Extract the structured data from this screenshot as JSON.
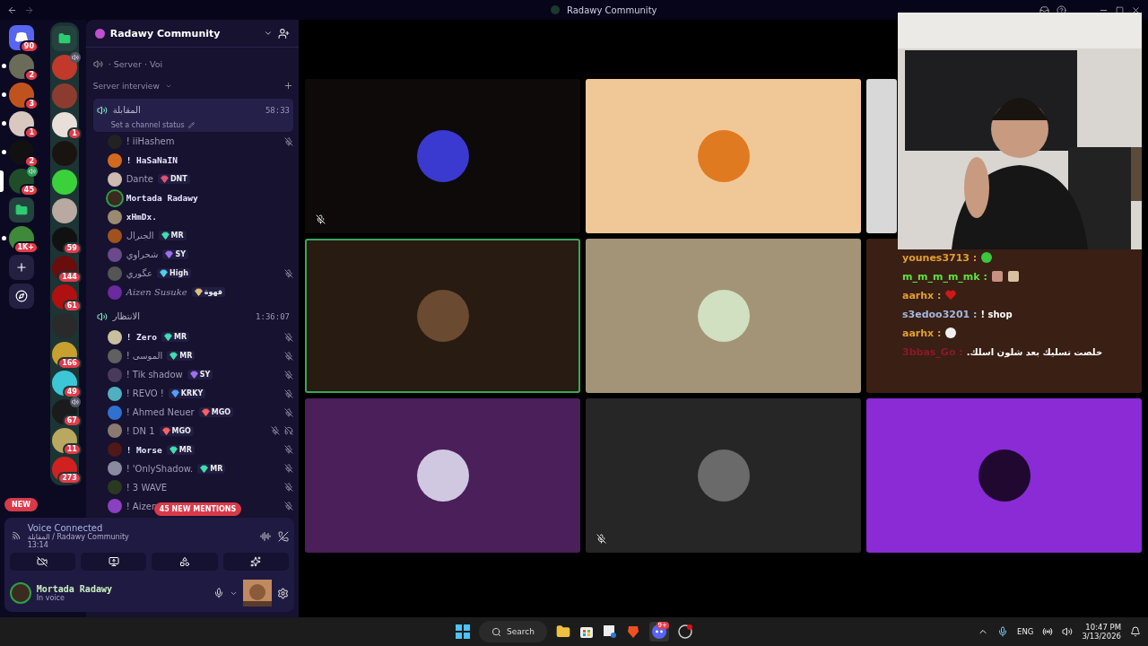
{
  "window": {
    "title": "Radawy Community"
  },
  "servers": [
    {
      "kind": "home",
      "color": "#5865f2",
      "badge": "90",
      "unread": false,
      "selected": false,
      "voice": false
    },
    {
      "kind": "server",
      "color": "#6b6b5a",
      "badge": "2",
      "unread": true,
      "selected": false,
      "voice": false
    },
    {
      "kind": "server",
      "color": "#c0531d",
      "badge": "3",
      "unread": true,
      "selected": false,
      "voice": false
    },
    {
      "kind": "server",
      "color": "#d8c8c0",
      "badge": "1",
      "unread": true,
      "selected": false,
      "voice": false
    },
    {
      "kind": "server",
      "color": "#111111",
      "badge": "2",
      "unread": true,
      "selected": false,
      "voice": false
    },
    {
      "kind": "server",
      "color": "#1f4d2a",
      "badge": "45",
      "unread": false,
      "selected": true,
      "voice": true
    },
    {
      "kind": "folder",
      "color": "#2ecc71",
      "unread": false,
      "selected": false,
      "voice": false
    },
    {
      "kind": "server",
      "color": "#3f8a3a",
      "badge": "1K+",
      "unread": true,
      "selected": false,
      "voice": false
    },
    {
      "kind": "add",
      "unread": false,
      "selected": false,
      "voice": false
    },
    {
      "kind": "explore",
      "unread": false,
      "selected": false,
      "voice": false
    }
  ],
  "folder": [
    {
      "kind": "folder",
      "color": "#2ecc71",
      "voice": false
    },
    {
      "kind": "server",
      "color": "#c0392b",
      "voice": true
    },
    {
      "kind": "server",
      "color": "#8e3b2f",
      "voice": false
    },
    {
      "kind": "server",
      "color": "#e8e0d8",
      "badge": "1",
      "voice": false
    },
    {
      "kind": "server",
      "color": "#1a1410",
      "voice": false
    },
    {
      "kind": "server",
      "color": "#3bd13b",
      "voice": false
    },
    {
      "kind": "server",
      "color": "#b9a9a0",
      "voice": false
    },
    {
      "kind": "server",
      "color": "#111111",
      "badge": "59",
      "voice": false
    },
    {
      "kind": "server",
      "color": "#6a0d0d",
      "badge": "144",
      "voice": false
    },
    {
      "kind": "server",
      "color": "#b01010",
      "badge": "61",
      "voice": false
    },
    {
      "kind": "server",
      "color": "#2a2a2a",
      "voice": false
    },
    {
      "kind": "server",
      "color": "#c8a030",
      "badge": "166",
      "voice": false
    },
    {
      "kind": "server",
      "color": "#3cc6d6",
      "badge": "49",
      "voice": false
    },
    {
      "kind": "server",
      "color": "#1b1b1b",
      "badge": "67",
      "voice": true
    },
    {
      "kind": "server",
      "color": "#b8a860",
      "badge": "11",
      "voice": false
    },
    {
      "kind": "server",
      "color": "#d02020",
      "badge": "273",
      "voice": false
    }
  ],
  "new_pill": "NEW",
  "guild": {
    "name": "Radawy Community",
    "partial_channel": "· Server · Voi",
    "category": "Server interview",
    "channels": [
      {
        "name": "المقابلة",
        "time": "58:33",
        "status": "Set a channel status",
        "members": [
          {
            "name": "! iiHashem",
            "kind": "plain",
            "muted": true,
            "deafened": false,
            "speaking": false
          },
          {
            "name": "! HaSaNaIN",
            "kind": "bold",
            "muted": false,
            "deafened": false,
            "speaking": false
          },
          {
            "name": "Dante",
            "kind": "plain",
            "tag": {
              "text": "DNT",
              "color": "#e0517a"
            },
            "muted": false,
            "deafened": false,
            "speaking": false
          },
          {
            "name": "Mortada Radawy",
            "kind": "bold",
            "muted": false,
            "deafened": false,
            "speaking": true
          },
          {
            "name": "xHmDx.",
            "kind": "bold",
            "muted": false,
            "deafened": false,
            "speaking": false
          },
          {
            "name": "الجنرال",
            "kind": "plain",
            "tag": {
              "text": "MR",
              "color": "#3fe0b0"
            },
            "muted": false,
            "deafened": false,
            "speaking": false
          },
          {
            "name": "شحراوي",
            "kind": "plain",
            "tag": {
              "text": "SY",
              "color": "#a070f0"
            },
            "muted": false,
            "deafened": false,
            "speaking": false
          },
          {
            "name": "عگوري",
            "kind": "plain",
            "tag": {
              "text": "High",
              "color": "#50d0f0"
            },
            "muted": true,
            "deafened": false,
            "speaking": false
          },
          {
            "name": "Aizen Susuke",
            "kind": "italic",
            "tag": {
              "text": "قهوة",
              "color": "#e0c080"
            },
            "muted": false,
            "deafened": false,
            "speaking": false
          }
        ]
      },
      {
        "name": "الانتظار",
        "time": "1:36:07",
        "members": [
          {
            "name": "! Zero",
            "kind": "bold",
            "tag": {
              "text": "MR",
              "color": "#3fe0b0"
            },
            "muted": true,
            "deafened": false,
            "speaking": false
          },
          {
            "name": "! الموسى",
            "kind": "plain",
            "tag": {
              "text": "MR",
              "color": "#3fe0b0"
            },
            "muted": true,
            "deafened": false,
            "speaking": false
          },
          {
            "name": "! Tik shadow",
            "kind": "plain",
            "tag": {
              "text": "SY",
              "color": "#a070f0"
            },
            "muted": true,
            "deafened": false,
            "speaking": false
          },
          {
            "name": "! REVO !",
            "kind": "plain",
            "tag": {
              "text": "KRKY",
              "color": "#50a0ff"
            },
            "muted": true,
            "deafened": false,
            "speaking": false
          },
          {
            "name": "! Ahmed Neuer",
            "kind": "plain",
            "tag": {
              "text": "MGO",
              "color": "#ff6060"
            },
            "muted": true,
            "deafened": false,
            "speaking": false
          },
          {
            "name": "! DN 1",
            "kind": "plain",
            "tag": {
              "text": "MGO",
              "color": "#ff6060"
            },
            "muted": true,
            "deafened": true,
            "speaking": false
          },
          {
            "name": "! Morse",
            "kind": "bold",
            "tag": {
              "text": "MR",
              "color": "#3fe0b0"
            },
            "muted": true,
            "deafened": false,
            "speaking": false
          },
          {
            "name": "! 'OnlyShadow.",
            "kind": "plain",
            "tag": {
              "text": "MR",
              "color": "#3fe0b0"
            },
            "muted": true,
            "deafened": false,
            "speaking": false
          },
          {
            "name": "! 3 WAVE",
            "kind": "plain",
            "muted": true,
            "deafened": false,
            "speaking": false
          },
          {
            "name": "! Aizen",
            "kind": "plain",
            "muted": true,
            "deafened": false,
            "speaking": false
          }
        ]
      }
    ],
    "mentions": "45 NEW MENTIONS"
  },
  "voice": {
    "title": "Voice Connected",
    "location": "المقابلة / Radawy Community",
    "elapsed": "13:14"
  },
  "user": {
    "name": "Mortada Radawy",
    "status": "In voice"
  },
  "tiles": [
    {
      "kind": "avatar",
      "color": "#0e0a0a",
      "muted": true,
      "speaking": false
    },
    {
      "kind": "avatar",
      "color": "#f0c898",
      "muted": false,
      "speaking": false
    },
    {
      "kind": "stream",
      "color": "#d8d8d8",
      "muted": false,
      "speaking": false
    },
    {
      "kind": "avatar",
      "color": "#271b12",
      "muted": false,
      "speaking": true
    },
    {
      "kind": "avatar",
      "color": "#a39478",
      "muted": false,
      "speaking": false
    },
    {
      "kind": "chat",
      "color": "#3a1f14",
      "muted": false,
      "speaking": false
    },
    {
      "kind": "avatar",
      "color": "#4a1f5a",
      "muted": false,
      "speaking": false
    },
    {
      "kind": "avatar",
      "color": "#262626",
      "muted": true,
      "speaking": false
    },
    {
      "kind": "avatar",
      "color": "#8a2bd6",
      "muted": false,
      "speaking": false
    }
  ],
  "chat": [
    {
      "user": "younes3713 :",
      "color": "#e0a030",
      "emojis": [
        {
          "kind": "blob"
        }
      ]
    },
    {
      "user": "m_m_m_m_mk :",
      "color": "#60e040",
      "emojis": [
        {
          "kind": "face"
        },
        {
          "kind": "cat"
        }
      ]
    },
    {
      "user": "aarhx :",
      "color": "#e0a030",
      "emojis": [
        {
          "kind": "heart"
        }
      ]
    },
    {
      "user": "s3edoo3201 :",
      "color": "#a0b8e0",
      "text": "! shop"
    },
    {
      "user": "aarhx :",
      "color": "#e0a030",
      "emojis": [
        {
          "kind": "skull"
        }
      ]
    },
    {
      "user": "3bbas_Go :",
      "color": "#8a1a2a",
      "text": "خلصت تسليك بعد شلون اسلك."
    }
  ],
  "taskbar": {
    "search": "Search",
    "discord_badge": "9+",
    "language": "ENG",
    "time": "10:47 PM",
    "date": "3/13/2026"
  }
}
